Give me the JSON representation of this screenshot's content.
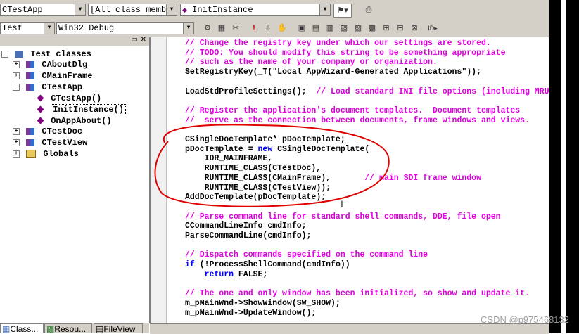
{
  "toolbar1": {
    "class_combo": "CTestApp",
    "filter_combo": "[All class members]",
    "member_combo": "InitInstance"
  },
  "toolbar2": {
    "project_combo": "Test",
    "config_combo": "Win32 Debug"
  },
  "tree": {
    "root": "Test classes",
    "items": [
      {
        "label": "CAboutDlg",
        "expander": "+"
      },
      {
        "label": "CMainFrame",
        "expander": "+"
      },
      {
        "label": "CTestApp",
        "expander": "−"
      },
      {
        "label": "CTestApp()"
      },
      {
        "label": "InitInstance()"
      },
      {
        "label": "OnAppAbout()"
      },
      {
        "label": "CTestDoc",
        "expander": "+"
      },
      {
        "label": "CTestView",
        "expander": "+"
      },
      {
        "label": "Globals",
        "expander": "+"
      }
    ]
  },
  "tabs": [
    "Class...",
    "Resou...",
    "FileView"
  ],
  "code_lines": [
    {
      "t": "// Change the registry key under which our settings are stored.",
      "c": "cm"
    },
    {
      "t": "// TODO: You should modify this string to be something appropriate",
      "c": "cm"
    },
    {
      "t": "// such as the name of your company or organization.",
      "c": "cm"
    },
    {
      "t": "SetRegistryKey(_T(\"Local AppWizard-Generated Applications\"));",
      "c": "tx"
    },
    {
      "t": "",
      "c": "tx"
    },
    {
      "t": "LoadStdProfileSettings();",
      "c": "tx",
      "tail": "  // Load standard INI file options (including MRU"
    },
    {
      "t": "",
      "c": "tx"
    },
    {
      "t": "// Register the application's document templates.  Document templates",
      "c": "cm"
    },
    {
      "t": "//  serve as the connection between documents, frame windows and views.",
      "c": "cm"
    },
    {
      "t": "",
      "c": "tx"
    },
    {
      "t": "CSingleDocTemplate* pDocTemplate;",
      "c": "tx"
    },
    {
      "t": "pDocTemplate = ",
      "c": "tx",
      "kw": "new",
      "rest": " CSingleDocTemplate("
    },
    {
      "t": "    IDR_MAINFRAME,",
      "c": "tx"
    },
    {
      "t": "    RUNTIME_CLASS(CTestDoc),",
      "c": "tx"
    },
    {
      "t": "    RUNTIME_CLASS(CMainFrame),",
      "c": "tx",
      "tail": "       // main SDI frame window"
    },
    {
      "t": "    RUNTIME_CLASS(CTestView));",
      "c": "tx"
    },
    {
      "t": "AddDocTemplate(pDocTemplate);",
      "c": "tx"
    },
    {
      "t": "",
      "c": "tx"
    },
    {
      "t": "// Parse command line for standard shell commands, DDE, file open",
      "c": "cm"
    },
    {
      "t": "CCommandLineInfo cmdInfo;",
      "c": "tx"
    },
    {
      "t": "ParseCommandLine(cmdInfo);",
      "c": "tx"
    },
    {
      "t": "",
      "c": "tx"
    },
    {
      "t": "// Dispatch commands specified on the command line",
      "c": "cm"
    },
    {
      "t": "",
      "c": "tx",
      "kw": "if",
      "rest": " (!ProcessShellCommand(cmdInfo))"
    },
    {
      "t": "    ",
      "c": "tx",
      "kw": "return",
      "rest": " FALSE;"
    },
    {
      "t": "",
      "c": "tx"
    },
    {
      "t": "// The one and only window has been initialized, so show and update it.",
      "c": "cm"
    },
    {
      "t": "m_pMainWnd->ShowWindow(SW_SHOW);",
      "c": "tx"
    },
    {
      "t": "m_pMainWnd->UpdateWindow();",
      "c": "tx"
    }
  ],
  "watermark": "CSDN @p975468132",
  "colors": {
    "comment": "#e000e0",
    "keyword": "#0000ff",
    "annotation": "#e00000"
  }
}
